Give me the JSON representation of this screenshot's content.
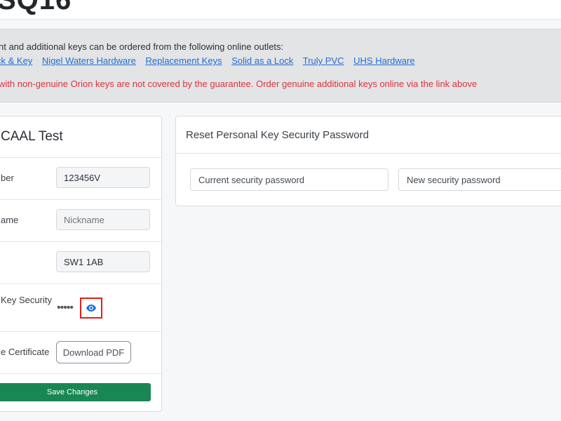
{
  "header": {
    "title": "SQ16"
  },
  "notice": {
    "intro": "nt and additional keys can be ordered from the following online outlets:",
    "links": [
      "ck & Key",
      "Nigel Waters Hardware",
      "Replacement Keys",
      "Solid as a Lock",
      "Truly PVC",
      "UHS Hardware"
    ],
    "warning": "with non-genuine Orion keys are not covered by the guarantee. Order genuine additional keys online via the link above",
    "warning_color": "#d9333f",
    "link_color": "#1f6dd6"
  },
  "lock_card": {
    "title": "CAAL Test",
    "fields": {
      "number_label": "ber",
      "number_value": "123456V",
      "nickname_label": "ame",
      "nickname_placeholder": "Nickname",
      "postcode_value": "SW1 1AB",
      "security_label": "Key Security",
      "security_dots": "•••••",
      "certificate_label": "e Certificate"
    },
    "download_label": "Download PDF",
    "save_label": "Save Changes",
    "save_color": "#198754"
  },
  "reset_card": {
    "title": "Reset Personal Key Security Password",
    "current_placeholder": "Current security password",
    "new_placeholder": "New security password"
  },
  "icons": {
    "reveal_password": "eye-icon"
  }
}
